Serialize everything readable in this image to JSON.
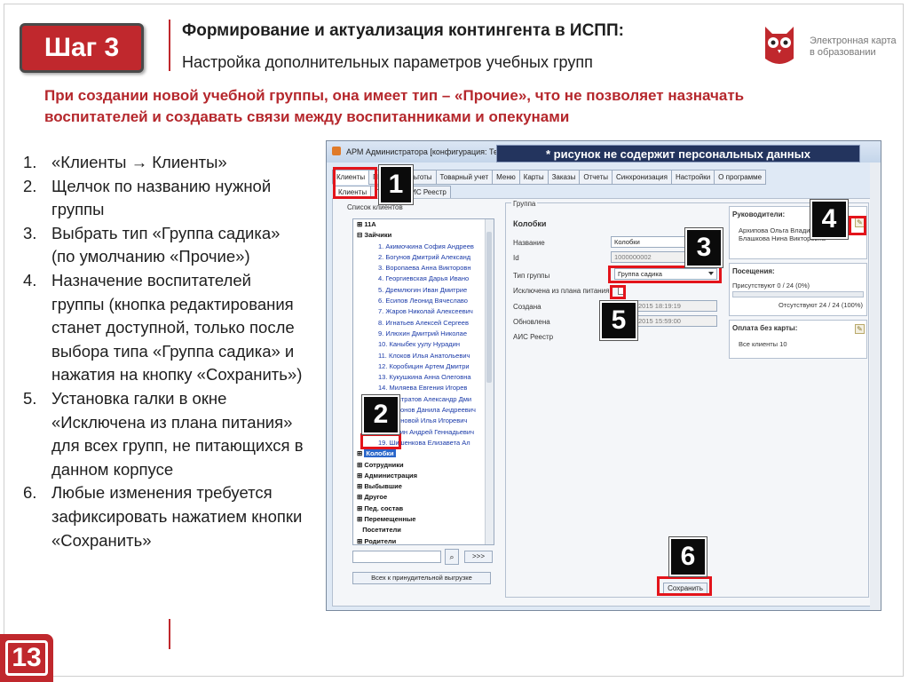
{
  "header": {
    "step": "Шаг 3",
    "title": "Формирование и актуализация контингента в ИСПП:",
    "subtitle": "Настройка дополнительных параметров учебных групп",
    "logo_text": [
      "Электронная карта",
      "в образовании"
    ]
  },
  "intro": "При создании новой учебной группы, она имеет тип – «Прочие», что не позволяет назначать воспитателей и создавать связи между воспитанниками и опекунами",
  "steps": [
    {
      "num": "1.",
      "text": "«Клиенты → Клиенты»"
    },
    {
      "num": "2.",
      "text": "Щелчок по названию нужной группы"
    },
    {
      "num": "3.",
      "text": "Выбрать тип «Группа садика» (по умолчанию «Прочие»)"
    },
    {
      "num": "4.",
      "text": "Назначение воспитателей группы (кнопка редактирования станет доступной, только после выбора типа «Группа садика» и нажатия на кнопку «Сохранить»)"
    },
    {
      "num": "5.",
      "text": "Установка галки в окне «Исключена из плана питания» для всех групп, не питающихся в данном корпусе"
    },
    {
      "num": "6.",
      "text": "Любые изменения требуется зафиксировать нажатием кнопки «Сохранить»"
    }
  ],
  "page_number": "13",
  "window": {
    "title": "АРМ Администратора [конфигурация: Те",
    "banner": "* рисунок не содержит персональных данных",
    "menu_tabs": [
      "Клиенты",
      "Питание",
      "Льготы",
      "Товарный учет",
      "Меню",
      "Карты",
      "Заказы",
      "Отчеты",
      "Синхронизация",
      "Настройки",
      "О программе"
    ],
    "sub_tabs": [
      "Клиенты",
      "Группы",
      "АИС Реестр"
    ],
    "client_list_label": "Список клиентов",
    "tree": {
      "top": "11А",
      "open_group": "Зайчики",
      "children": [
        "1. Акимочкина София Андреев",
        "2. Богунов Дмитрий Александ",
        "3. Воропаева Анна Викторовн",
        "4. Георгиевская Дарья Ивано",
        "5. Дремлюгин Иван Дмитрие",
        "6. Есипов Леонид Вячеславо",
        "7. Жаров Николай Алексеевич",
        "8. Игнатьев Алексей Сергеев",
        "9. Илюхин Дмитрий Николае",
        "10. Каныбек уулу Нурадин",
        "11. Клоков Илья Анатольевич",
        "12. Коробицин Артем Дмитри",
        "13. Кукушкина Анна Олеговна",
        "14. Миляева Евгения Игорев",
        "15. Нистратов Александр Дми",
        "16. Антонов Данила Андреевич",
        "17. Бруновой Илья Игоревич",
        "18. Ракин Андрей Геннадьевич",
        "19. Шишенкова Елизавета Ал"
      ],
      "selected": "Колобки",
      "groups": [
        "Сотрудники",
        "Администрация",
        "Выбывшие",
        "Другое",
        "Пед. состав",
        "Перемещенные",
        "Посетители",
        "Родители"
      ]
    },
    "search_next": ">>>",
    "forced_export_button": "Всех к принудительной выгрузке",
    "group_label": "Группа",
    "group_name": "Колобки",
    "fields": {
      "name_label": "Название",
      "name_value": "Колобки",
      "id_label": "Id",
      "id_value": "1000000002",
      "type_label": "Тип группы",
      "type_value": "Группа садика",
      "excluded_label": "Исключена из плана питания",
      "created_label": "Создана",
      "created_value": "2015 18:19:19",
      "updated_label": "Обновлена",
      "updated_value": "2015 15:59:00",
      "ais_label": "АИС Реестр"
    },
    "leaders": {
      "label": "Руководители:",
      "names": [
        "Архипова Ольга Владимировна",
        "Блашкова Нина Викторовна"
      ]
    },
    "attendance": {
      "label": "Посещения:",
      "present": "Присутствуют 0 / 24 (0%)",
      "present_fraction": 0,
      "absent": "Отсутствуют 24 / 24 (100%)",
      "absent_fraction": 1
    },
    "no_card": {
      "label": "Оплата без карты:",
      "value": "Все клиенты 10"
    },
    "save_button": "Сохранить",
    "markers": [
      "1",
      "2",
      "3",
      "4",
      "5",
      "6"
    ]
  },
  "colors": {
    "accent": "#c0282d",
    "highlight": "#e3141b",
    "banner": "#23345e",
    "link": "#1a3aa8"
  }
}
